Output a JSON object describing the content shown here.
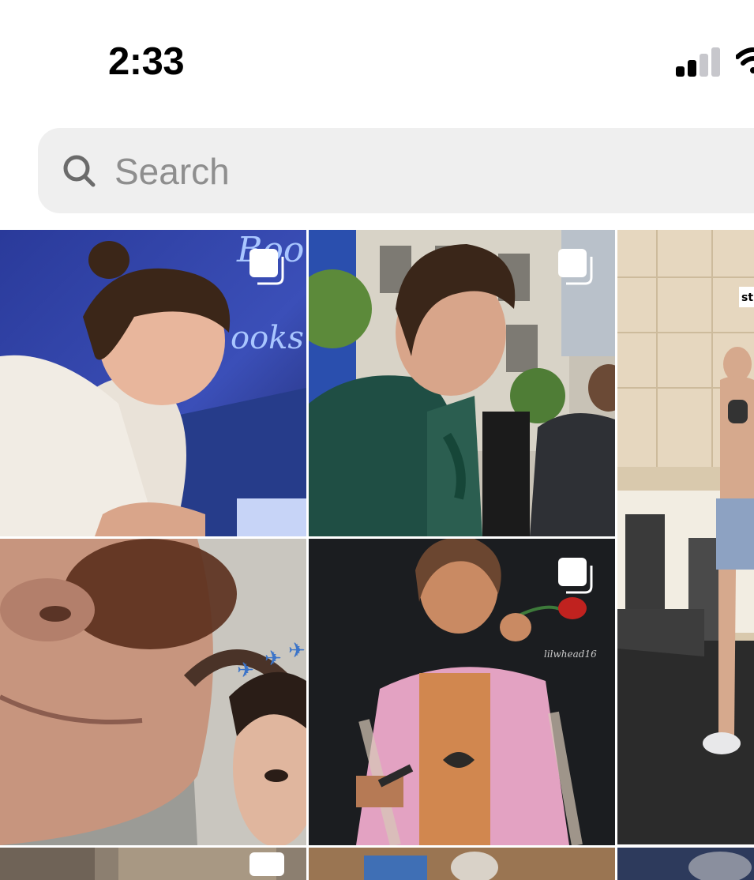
{
  "status_bar": {
    "time": "2:33",
    "icons": [
      "cellular-signal-icon",
      "wifi-icon"
    ]
  },
  "search": {
    "placeholder": "Search",
    "icon": "search-icon"
  },
  "grid": {
    "tiles": [
      {
        "name": "post-man-bun-signing",
        "multiple": true
      },
      {
        "name": "post-green-suit-street",
        "multiple": true
      },
      {
        "name": "post-gym-woman",
        "multiple": false,
        "sticker_text": "st"
      },
      {
        "name": "post-sunglasses-selfie",
        "multiple": false
      },
      {
        "name": "post-fringe-jacket-rose",
        "multiple": true,
        "watermark": "lilwhead16"
      },
      {
        "name": "post-partial-row-1",
        "multiple": false
      },
      {
        "name": "post-partial-row-2",
        "multiple": false
      },
      {
        "name": "post-partial-row-3",
        "multiple": false
      }
    ]
  },
  "colors": {
    "search_bg": "#efefef",
    "placeholder": "#8e8e8e",
    "text": "#000000"
  }
}
